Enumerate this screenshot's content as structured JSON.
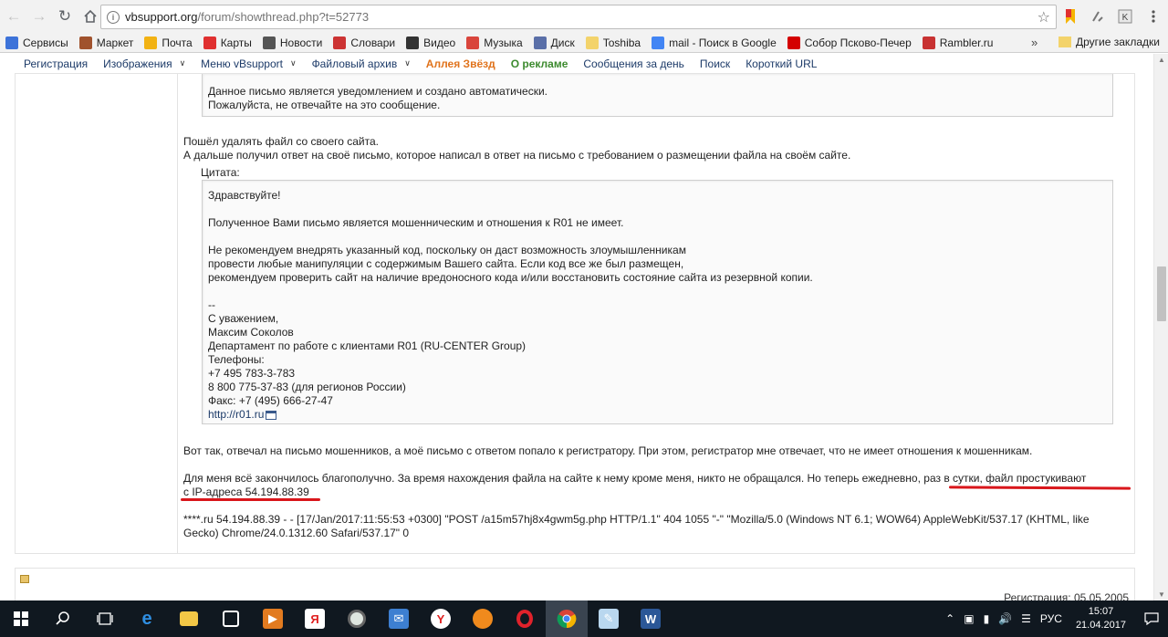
{
  "browser": {
    "url_host": "vbsupport.org",
    "url_path": "/forum/showthread.php?t=52773",
    "bookmarks": [
      {
        "label": "Сервисы",
        "color": "#3d73d9",
        "icon": "apps-icon"
      },
      {
        "label": "Маркет",
        "color": "#a0522d",
        "icon": "market-icon"
      },
      {
        "label": "Почта",
        "color": "#f2b213",
        "icon": "mail-icon"
      },
      {
        "label": "Карты",
        "color": "#e03030",
        "icon": "map-pin-icon"
      },
      {
        "label": "Новости",
        "color": "#555555",
        "icon": "news-icon"
      },
      {
        "label": "Словари",
        "color": "#cc3333",
        "icon": "dictionary-icon"
      },
      {
        "label": "Видео",
        "color": "#333333",
        "icon": "video-icon"
      },
      {
        "label": "Музыка",
        "color": "#d9453c",
        "icon": "music-icon"
      },
      {
        "label": "Диск",
        "color": "#5a6fa8",
        "icon": "disk-icon"
      },
      {
        "label": "Toshiba",
        "color": "#f3d36b",
        "icon": "folder-icon"
      },
      {
        "label": "mail - Поиск в Google",
        "color": "#4285f4",
        "icon": "google-icon"
      },
      {
        "label": "Собор Псково-Печер",
        "color": "#d40000",
        "icon": "yandex-icon"
      },
      {
        "label": "Rambler.ru",
        "color": "#c83232",
        "icon": "rambler-icon"
      }
    ],
    "more_label": "»",
    "other_bookmarks": "Другие закладки"
  },
  "forum_nav": {
    "items": [
      {
        "label": "Регистрация",
        "style": "normal",
        "dropdown": false
      },
      {
        "label": "Изображения",
        "style": "normal",
        "dropdown": true
      },
      {
        "label": "Меню vBsupport",
        "style": "normal",
        "dropdown": true
      },
      {
        "label": "Файловый архив",
        "style": "normal",
        "dropdown": true
      },
      {
        "label": "Аллея Звёзд",
        "style": "orange",
        "dropdown": false
      },
      {
        "label": "О рекламе",
        "style": "green",
        "dropdown": false
      },
      {
        "label": "Сообщения за день",
        "style": "normal",
        "dropdown": false
      },
      {
        "label": "Поиск",
        "style": "normal",
        "dropdown": false
      },
      {
        "label": "Короткий URL",
        "style": "normal",
        "dropdown": false
      }
    ]
  },
  "post": {
    "top_quote_lines": [
      "Данное письмо является уведомлением и создано автоматически.",
      "Пожалуйста, не отвечайте на это сообщение."
    ],
    "para1": [
      "Пошёл удалять файл со своего сайта.",
      "А дальше получил ответ на своё письмо, которое написал в ответ на письмо с требованием о размещении файла на своём сайте."
    ],
    "quote_label": "Цитата:",
    "quote_lines": [
      "Здравствуйте!",
      "",
      "Полученное Вами письмо является мошенническим и отношения к R01 не имеет.",
      "",
      "Не рекомендуем внедрять указанный код, поскольку он даст возможность злоумышленникам",
      "провести любые манипуляции с содержимым Вашего сайта. Если код все же был размещен,",
      "рекомендуем проверить сайт на наличие вредоносного кода и/или восстановить состояние сайта из резервной копии.",
      "",
      "--",
      "С уважением,",
      "Максим Соколов",
      "Департамент по работе с клиентами R01 (RU-CENTER Group)",
      "Телефоны:",
      "+7 495 783-3-783",
      "8 800 775-37-83 (для регионов России)",
      "Факс: +7 (495) 666-27-47"
    ],
    "quote_link": "http://r01.ru",
    "para2": "Вот так, отвечал на письмо мошенников, а моё письмо с ответом попало к регистратору. При этом, регистратор мне отвечает, что не имеет отношения к мошенникам.",
    "para3_line1": "Для меня всё закончилось благополучно. За время нахождения файла на сайте к нему кроме меня, никто не обращался. Но теперь ежедневно, раз в сутки, файл простукивают",
    "para3_line2": "с IP-адреса 54.194.88.39",
    "log_line1": "****.ru 54.194.88.39 - - [17/Jan/2017:11:55:53 +0300] \"POST /a15m57hj8x4gwm5g.php HTTP/1.1\" 404 1055 \"-\" \"Mozilla/5.0 (Windows NT 6.1; WOW64) AppleWebKit/537.17 (KHTML, like",
    "log_line2": "Gecko) Chrome/24.0.1312.60 Safari/537.17\" 0",
    "underline_color": "#d9161b"
  },
  "next_post": {
    "registration": "Регистрация: 05.05.2005"
  },
  "taskbar": {
    "language": "РУС",
    "time": "15:07",
    "date": "21.04.2017"
  }
}
